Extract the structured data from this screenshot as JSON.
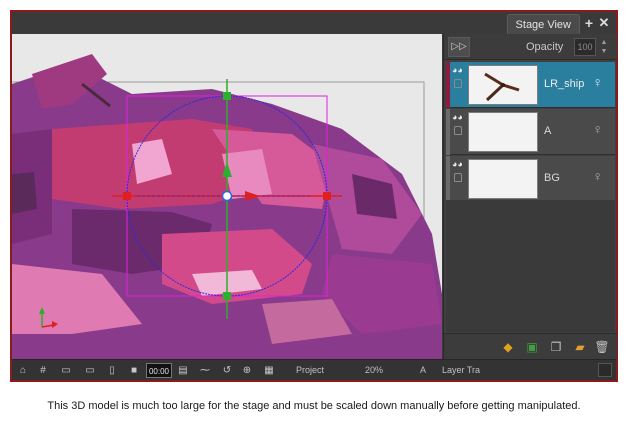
{
  "window": {
    "tab_title": "Stage View",
    "add_icon": "plus-icon",
    "close_icon": "close-icon"
  },
  "timeline": {
    "forward_icon": "fast-forward-icon",
    "opacity_label": "Opacity",
    "opacity_value": "100",
    "layers": [
      {
        "name": "LR_ship",
        "selected": true
      },
      {
        "name": "A",
        "selected": false
      },
      {
        "name": "BG",
        "selected": false
      }
    ]
  },
  "bottombar": {
    "counter": "00:00",
    "view_mode": "Project",
    "zoom": "20%",
    "a_label": "A",
    "layer_transform": "Layer Tra"
  },
  "caption": "This 3D model is much too large for the stage and must be scaled down manually before getting manipulated.",
  "colors": {
    "accent_selected_layer": "#2b7f9e",
    "frame_border": "#8b1a1a",
    "model_magenta": "#b83a78",
    "model_purple": "#8a3a8a",
    "bounding_box": "#e020e0",
    "rotation_circle": "#2a2ae0"
  }
}
